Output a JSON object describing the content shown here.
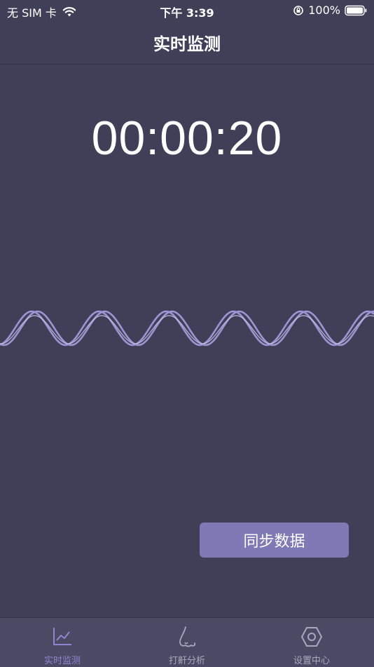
{
  "status_bar": {
    "carrier": "无 SIM 卡",
    "time": "下午 3:39",
    "battery": "100%",
    "icons": [
      "wifi-icon",
      "rotation-lock-icon",
      "battery-icon"
    ]
  },
  "nav": {
    "title": "实时监测"
  },
  "timer": {
    "value": "00:00:20"
  },
  "actions": {
    "sync_label": "同步数据"
  },
  "tabs": [
    {
      "label": "实时监测",
      "icon": "chart-icon",
      "active": true
    },
    {
      "label": "打鼾分析",
      "icon": "nose-icon",
      "active": false
    },
    {
      "label": "设置中心",
      "icon": "hexagon-settings-icon",
      "active": false
    }
  ],
  "colors": {
    "background": "#3f4058",
    "accent": "#7f79b5",
    "wave": "#9b95d3",
    "tab_bar": "#4a4a64"
  }
}
